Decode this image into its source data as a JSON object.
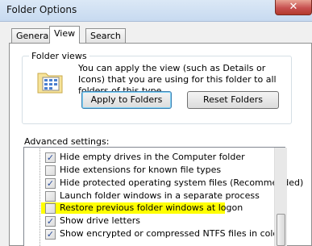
{
  "window": {
    "title": "Folder Options"
  },
  "tabs": [
    {
      "label": "General",
      "active": false
    },
    {
      "label": "View",
      "active": true
    },
    {
      "label": "Search",
      "active": false
    }
  ],
  "folder_views": {
    "label": "Folder views",
    "description": "You can apply the view (such as Details or Icons) that you are using for this folder to all folders of this type.",
    "apply_button": "Apply to Folders",
    "reset_button": "Reset Folders"
  },
  "advanced": {
    "label": "Advanced settings:",
    "items": [
      {
        "label": "Hide empty drives in the Computer folder",
        "checked": true
      },
      {
        "label": "Hide extensions for known file types",
        "checked": false
      },
      {
        "label": "Hide protected operating system files (Recommended)",
        "checked": true
      },
      {
        "label": "Launch folder windows in a separate process",
        "checked": false
      },
      {
        "label": "Restore previous folder windows at logon",
        "checked": false
      },
      {
        "label": "Show drive letters",
        "checked": true
      },
      {
        "label": "Show encrypted or compressed NTFS files in color",
        "checked": true
      }
    ]
  },
  "colors": {
    "highlight": "#ffff00",
    "check": "#2a4d9a"
  }
}
